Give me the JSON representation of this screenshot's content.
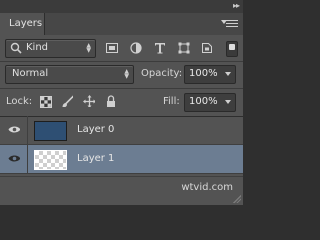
{
  "panel": {
    "tab_label": "Layers",
    "collapse_glyph": "▸▸",
    "menu_icon": "panel-menu-icon"
  },
  "filter": {
    "kind_label": "Kind",
    "icons": [
      "pixel-filter-icon",
      "adjustment-filter-icon",
      "type-filter-icon",
      "shape-filter-icon",
      "smart-object-filter-icon"
    ],
    "toggle_icon": "filter-toggle-icon"
  },
  "blend": {
    "mode": "Normal",
    "opacity_label": "Opacity:",
    "opacity_value": "100%"
  },
  "lock": {
    "label": "Lock:",
    "icons": [
      "lock-transparent-pixels-icon",
      "lock-image-pixels-icon",
      "lock-position-icon",
      "lock-all-icon"
    ],
    "fill_label": "Fill:",
    "fill_value": "100%"
  },
  "layers": [
    {
      "name": "Layer 0",
      "visible": true,
      "selected": false,
      "thumb": "blue"
    },
    {
      "name": "Layer 1",
      "visible": true,
      "selected": true,
      "thumb": "transparent"
    }
  ],
  "watermark": "wtvid.com",
  "colors": {
    "panel_bg": "#535353",
    "selection": "#6c7d92",
    "layer0_thumb": "#2e4f73"
  }
}
